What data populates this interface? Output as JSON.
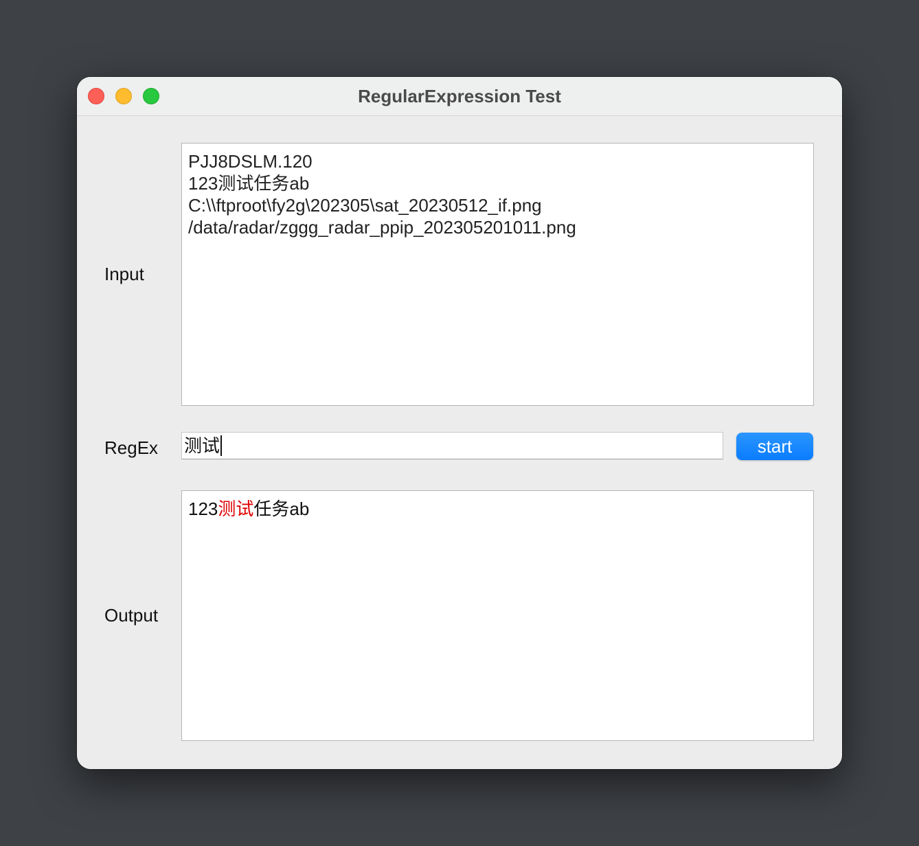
{
  "window": {
    "title": "RegularExpression Test"
  },
  "labels": {
    "input": "Input",
    "regex": "RegEx",
    "output": "Output"
  },
  "input": {
    "lines": [
      "PJJ8DSLM.120",
      "123测试任务ab",
      "C:\\\\ftproot\\fy2g\\202305\\sat_20230512_if.png",
      "/data/radar/zggg_radar_ppip_202305201011.png"
    ]
  },
  "regex": {
    "value": "测试"
  },
  "start_button": {
    "label": "start"
  },
  "output": {
    "prefix": "123",
    "match": "测试",
    "suffix": "任务ab"
  },
  "colors": {
    "match_highlight": "#e00000",
    "button_accent": "#0a7cff"
  }
}
